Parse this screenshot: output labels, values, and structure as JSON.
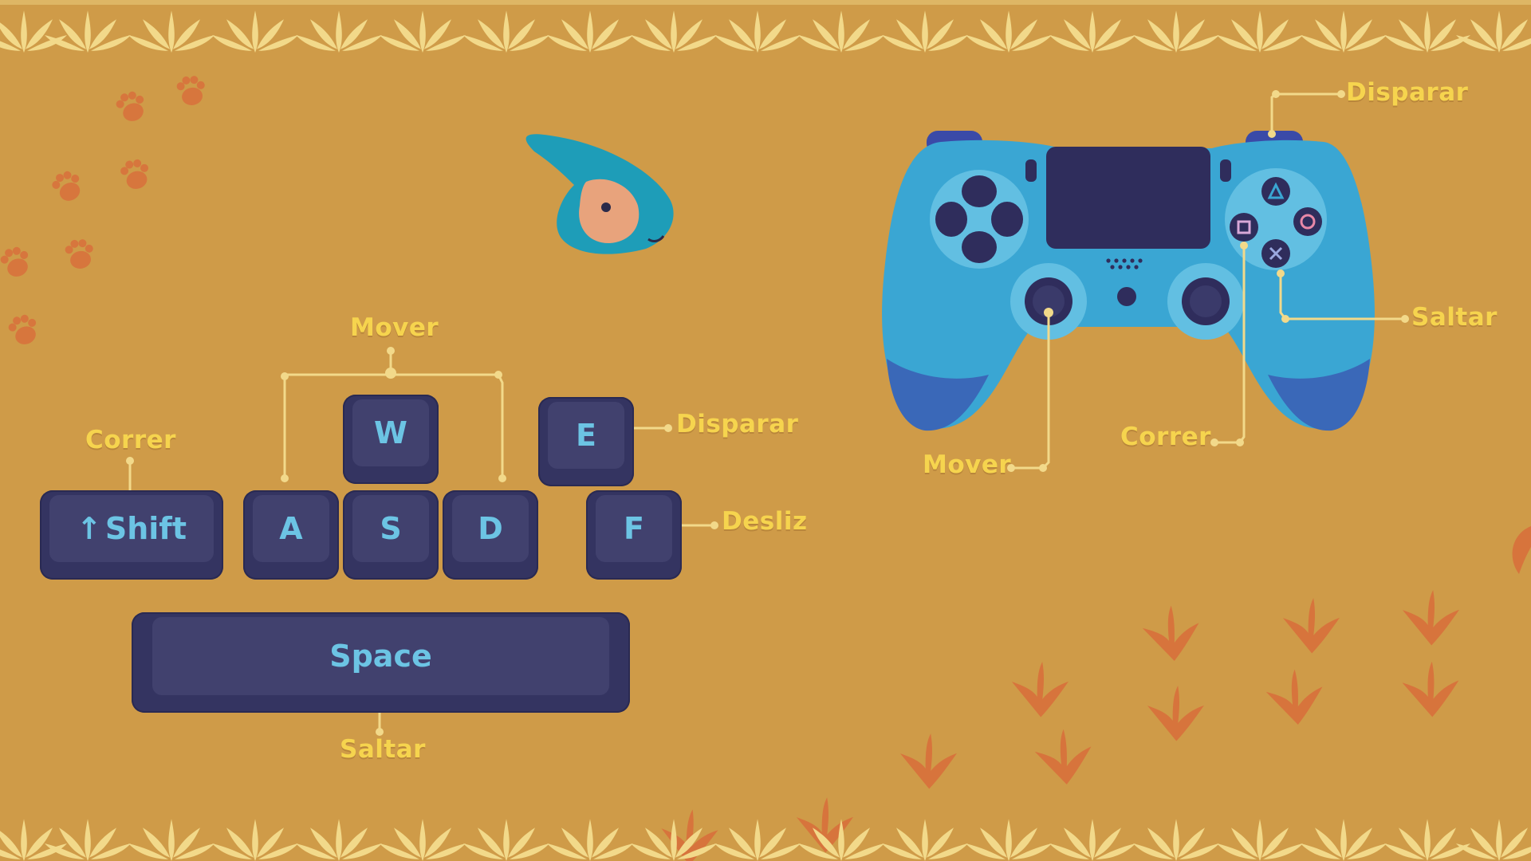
{
  "keyboard": {
    "keys": {
      "w": "W",
      "a": "A",
      "s": "S",
      "d": "D",
      "e": "E",
      "f": "F",
      "shift": "Shift",
      "space": "Space"
    },
    "labels": {
      "move": "Mover",
      "run": "Correr",
      "shoot": "Disparar",
      "slide": "Desliz",
      "jump": "Saltar"
    }
  },
  "controller": {
    "labels": {
      "shoot": "Disparar",
      "jump": "Saltar",
      "run": "Correr",
      "move": "Mover"
    }
  },
  "colors": {
    "background": "#cf9b48",
    "label": "#f6d44e",
    "key_body": "#343461",
    "key_top": "#41416e",
    "key_text": "#6cc4e4",
    "controller_body": "#3aa6d3",
    "controller_dark": "#2f2d5c",
    "paw_print": "#d9703c"
  }
}
